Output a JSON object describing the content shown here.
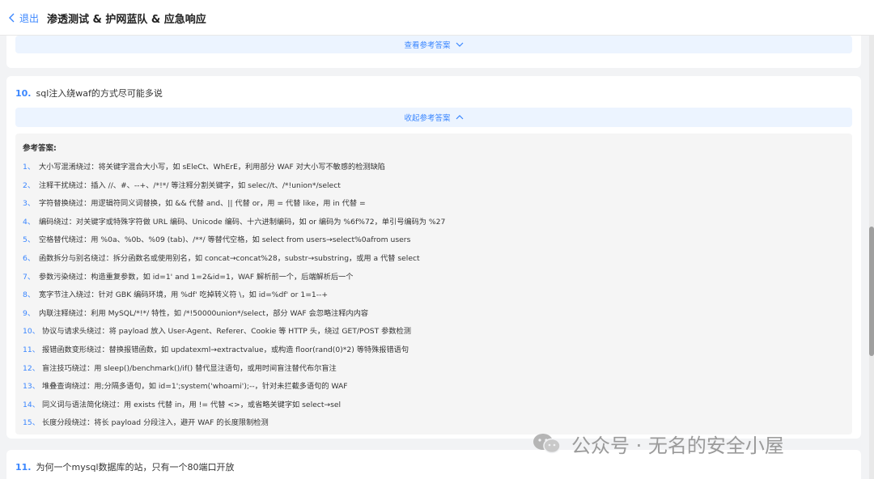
{
  "header": {
    "back_label": "退出",
    "title": "渗透测试 & 护网蓝队 & 应急响应"
  },
  "card_prev": {
    "toggle_label": "查看参考答案"
  },
  "question10": {
    "number": "10.",
    "text": "sql注入绕waf的方式尽可能多说",
    "toggle_label": "收起参考答案",
    "answer_label": "参考答案:",
    "items": [
      {
        "num": "1、",
        "text": "大小写混淆绕过：将关键字混合大小写，如 sEleCt、WhErE，利用部分 WAF 对大小写不敏感的检测缺陷"
      },
      {
        "num": "2、",
        "text": "注释干扰绕过：插入 //、#、--+、/*!*/ 等注释分割关键字，如 selec//t、/*!union*/select"
      },
      {
        "num": "3、",
        "text": "字符替换绕过：用逻辑符同义词替换，如 && 代替 and、|| 代替 or，用 = 代替 like，用 in 代替 ="
      },
      {
        "num": "4、",
        "text": "编码绕过：对关键字或特殊字符做 URL 编码、Unicode 编码、十六进制编码，如 or 编码为 %6f%72，单引号编码为 %27"
      },
      {
        "num": "5、",
        "text": "空格替代绕过：用 %0a、%0b、%09 (tab)、/**/ 等替代空格，如 select from users→select%0afrom users"
      },
      {
        "num": "6、",
        "text": "函数拆分与别名绕过：拆分函数名或使用别名，如 concat→concat%28，substr→substring，或用 a 代替 select"
      },
      {
        "num": "7、",
        "text": "参数污染绕过：构造重复参数，如 id=1' and 1=2&id=1，WAF 解析前一个，后端解析后一个"
      },
      {
        "num": "8、",
        "text": "宽字节注入绕过：针对 GBK 编码环境，用 %df' 吃掉转义符 \\，如 id=%df' or 1=1--+"
      },
      {
        "num": "9、",
        "text": "内联注释绕过：利用 MySQL/*!*/ 特性，如 /*!50000union*/select，部分 WAF 会忽略注释内内容"
      },
      {
        "num": "10、",
        "text": "协议与请求头绕过：将 payload 放入 User-Agent、Referer、Cookie 等 HTTP 头，绕过 GET/POST 参数检测"
      },
      {
        "num": "11、",
        "text": "报错函数变形绕过：替换报错函数，如 updatexml→extractvalue，或构造 floor(rand(0)*2) 等特殊报错语句"
      },
      {
        "num": "12、",
        "text": "盲注技巧绕过：用 sleep()/benchmark()/if() 替代显注语句，或用时间盲注替代布尔盲注"
      },
      {
        "num": "13、",
        "text": "堆叠查询绕过：用;分隔多语句，如 id=1';system('whoami');--，针对未拦截多语句的 WAF"
      },
      {
        "num": "14、",
        "text": "同义词与语法简化绕过：用 exists 代替 in，用 != 代替 <>，或省略关键字如 select→sel"
      },
      {
        "num": "15、",
        "text": "长度分段绕过：将长 payload 分段注入，避开 WAF 的长度限制检测"
      }
    ]
  },
  "question11": {
    "number": "11.",
    "text": "为何一个mysql数据库的站，只有一个80端口开放"
  },
  "watermark": {
    "text": "公众号 · 无名的安全小屋"
  },
  "colors": {
    "accent": "#3a86ff",
    "page_bg": "#f2f3f5",
    "answer_bg": "#f5f5f5",
    "toggle_bg": "#ecf4ff"
  }
}
